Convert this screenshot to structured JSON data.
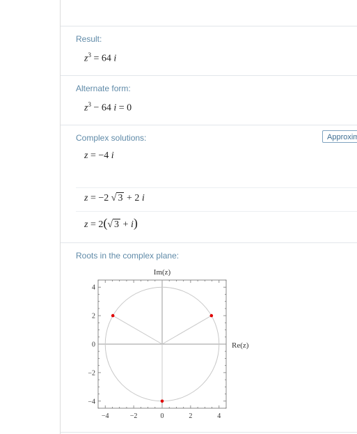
{
  "pods": {
    "result": {
      "title": "Result:",
      "base": "z",
      "exp": "3",
      "rhs": "= 64",
      "unit": "i"
    },
    "alternate": {
      "title": "Alternate form:",
      "base": "z",
      "exp": "3",
      "rest": "− 64",
      "unit": "i",
      "tail": "= 0"
    },
    "complex": {
      "title": "Complex solutions:",
      "approx_button": "Approximate form",
      "sol1": {
        "z": "z",
        "eq": "= −4",
        "i": "i"
      },
      "sol2": {
        "z": "z",
        "eq": "= −2",
        "root": "3",
        "plus": "+ 2",
        "i": "i"
      },
      "sol3": {
        "z": "z",
        "eq": "= 2",
        "root": "3",
        "plus": "+",
        "i": "i"
      }
    },
    "roots": {
      "title": "Roots in the complex plane:"
    }
  },
  "chart_data": {
    "type": "scatter",
    "xlabel": "Re(z)",
    "ylabel": "Im(z)",
    "xlim": [
      -4.5,
      4.5
    ],
    "ylim": [
      -4.5,
      4.5
    ],
    "x_ticks": [
      -4,
      -2,
      0,
      2,
      4
    ],
    "y_ticks": [
      -4,
      -2,
      0,
      2,
      4
    ],
    "x_tick_labels": [
      "−4",
      "−2",
      "0",
      "2",
      "4"
    ],
    "y_tick_labels": [
      "−4",
      "−2",
      "0",
      "2",
      "4"
    ],
    "circle_radius": 4,
    "points": [
      {
        "x": -3.464,
        "y": 2
      },
      {
        "x": 3.464,
        "y": 2
      },
      {
        "x": 0,
        "y": -4
      }
    ],
    "point_color": "#e00000",
    "line_color": "#c8c8c8",
    "grid": false
  }
}
